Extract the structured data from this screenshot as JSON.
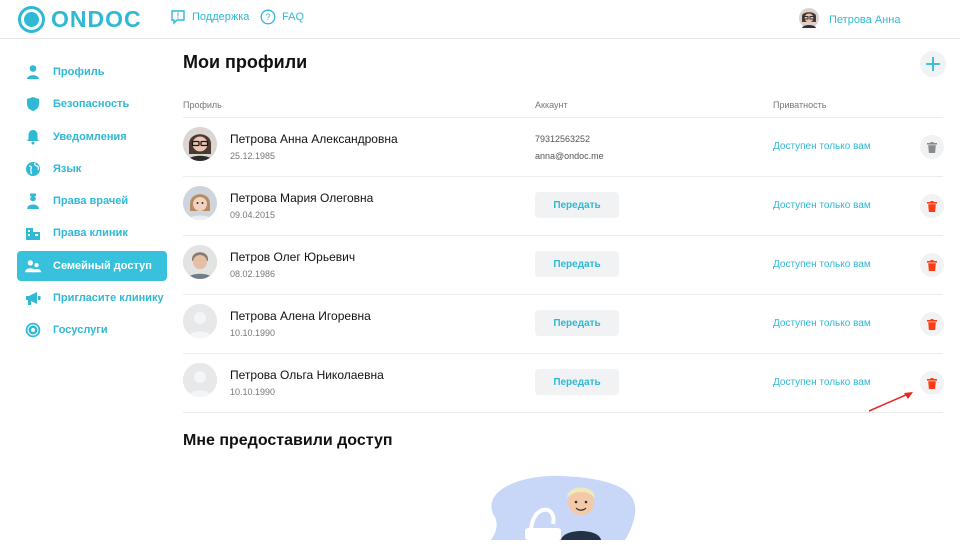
{
  "header": {
    "logo_text": "ONDOC",
    "support_label": "Поддержка",
    "faq_label": "FAQ",
    "user_name": "Петрова Анна"
  },
  "sidebar": {
    "items": [
      {
        "label": "Профиль",
        "icon": "person-icon"
      },
      {
        "label": "Безопасность",
        "icon": "shield-icon"
      },
      {
        "label": "Уведомления",
        "icon": "bell-icon"
      },
      {
        "label": "Язык",
        "icon": "globe-icon"
      },
      {
        "label": "Права врачей",
        "icon": "doctor-icon"
      },
      {
        "label": "Права клиник",
        "icon": "clinic-icon"
      },
      {
        "label": "Семейный доступ",
        "icon": "family-icon",
        "active": true
      },
      {
        "label": "Пригласите клинику",
        "icon": "megaphone-icon"
      },
      {
        "label": "Госуслуги",
        "icon": "gosuslugi-icon"
      }
    ]
  },
  "main": {
    "title": "Мои профили",
    "columns": {
      "profile": "Профиль",
      "account": "Аккаунт",
      "privacy": "Приватность"
    },
    "profiles": [
      {
        "name": "Петрова Анна Александровна",
        "date": "25.12.1985",
        "phone": "79312563252",
        "email": "anna@ondoc.me",
        "privacy": "Доступен только вам",
        "avatar": "photo-woman-glasses"
      },
      {
        "name": "Петрова Мария Олеговна",
        "date": "09.04.2015",
        "button": "Передать",
        "privacy": "Доступен только вам",
        "avatar": "photo-child"
      },
      {
        "name": "Петров Олег Юрьевич",
        "date": "08.02.1986",
        "button": "Передать",
        "privacy": "Доступен только вам",
        "avatar": "photo-man"
      },
      {
        "name": "Петрова Алена Игоревна",
        "date": "10.10.1990",
        "button": "Передать",
        "privacy": "Доступен только вам",
        "avatar": "placeholder"
      },
      {
        "name": "Петрова Ольга Николаевна",
        "date": "10.10.1990",
        "button": "Передать",
        "privacy": "Доступен только вам",
        "avatar": "placeholder"
      }
    ],
    "shared_title": "Мне предоставили доступ"
  },
  "colors": {
    "accent": "#2fb9d4",
    "delete": "#ff3b14",
    "delete_disabled": "#8a8a8a",
    "annotation_arrow": "#e8281e"
  }
}
